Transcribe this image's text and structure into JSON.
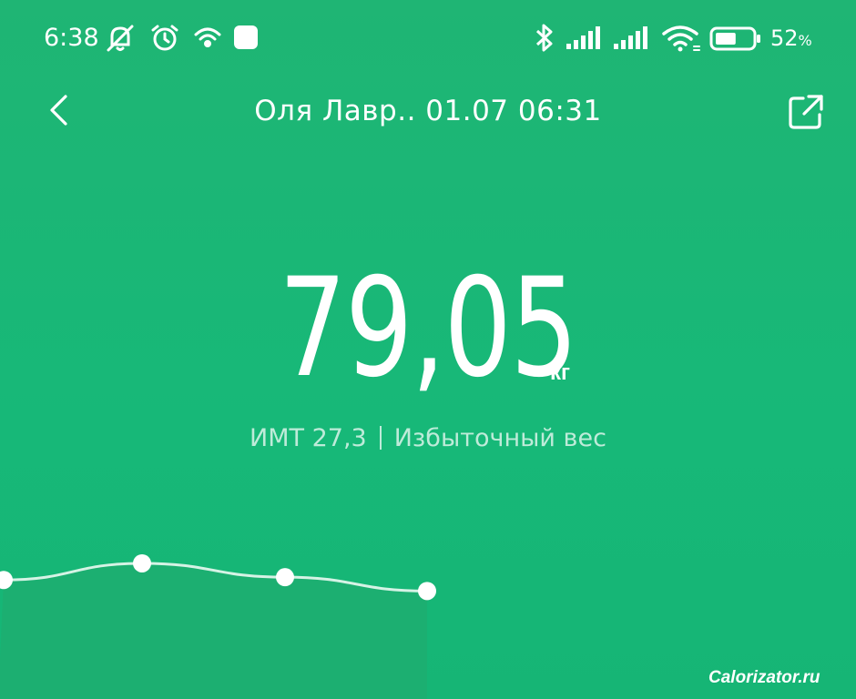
{
  "status_bar": {
    "time": "6:38",
    "battery_percent": "52",
    "battery_percent_sign": "%",
    "battery_level": 0.52,
    "icons": [
      "bell-off-icon",
      "alarm-icon",
      "hotspot-icon",
      "notification-square-icon",
      "bluetooth-icon",
      "signal-icon",
      "signal-icon",
      "wifi-icon",
      "battery-icon"
    ]
  },
  "header": {
    "title": "Оля Лавр.. 01.07 06:31",
    "back_icon": "chevron-left-icon",
    "share_icon": "share-icon"
  },
  "measurement": {
    "weight": "79,05",
    "unit": "кг",
    "bmi_text": "ИМТ 27,3",
    "bmi_status": "Избыточный вес"
  },
  "chart_data": {
    "type": "line",
    "x": [
      1,
      2,
      3,
      4
    ],
    "values": [
      79.0,
      79.3,
      79.05,
      78.8
    ],
    "ylim": [
      78,
      80
    ],
    "grid": false,
    "line_color": "#d5f3e5",
    "point_color": "#ffffff",
    "fill_color": "#22a96e"
  },
  "watermark": "Calorizator.ru",
  "colors": {
    "background": "#17b878",
    "text": "#ffffff",
    "muted_text": "#bfeed8"
  }
}
